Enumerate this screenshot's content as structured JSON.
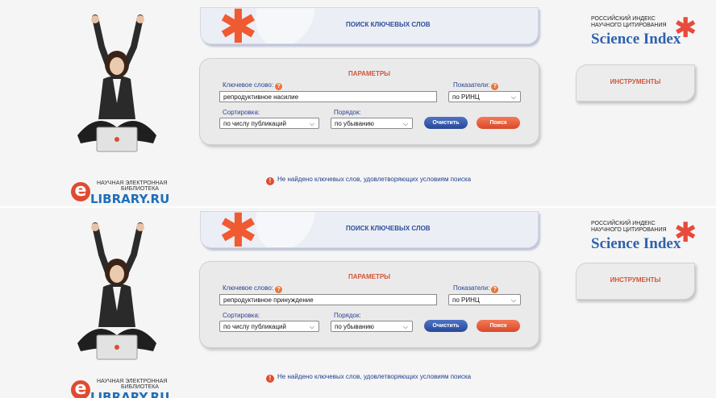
{
  "panels": [
    {
      "title": "ПОИСК КЛЮЧЕВЫХ СЛОВ",
      "params_title": "ПАРАМЕТРЫ",
      "keyword_label": "Ключевое слово:",
      "keyword_value": "репродуктивное насилие",
      "indicators_label": "Показатели:",
      "indicators_value": "по РИНЦ",
      "sort_label": "Сортировка:",
      "sort_value": "по числу публикаций",
      "order_label": "Порядок:",
      "order_value": "по убыванию",
      "clear_button": "Очистить",
      "search_button": "Поиск",
      "tools_title": "ИНСТРУМЕНТЫ",
      "message": "Не найдено ключевых слов, удовлетворяющих условиям поиска",
      "science_index": {
        "line1": "РОССИЙСКИЙ ИНДЕКС",
        "line2": "НАУЧНОГО ЦИТИРОВАНИЯ",
        "brand": "Science Index"
      },
      "elibrary": {
        "line1": "НАУЧНАЯ ЭЛЕКТРОННАЯ",
        "line2": "БИБЛИОТЕКА",
        "brand": "LIBRARY.RU"
      }
    },
    {
      "title": "ПОИСК КЛЮЧЕВЫХ СЛОВ",
      "params_title": "ПАРАМЕТРЫ",
      "keyword_label": "Ключевое слово:",
      "keyword_value": "репродуктивное принуждение",
      "indicators_label": "Показатели:",
      "indicators_value": "по РИНЦ",
      "sort_label": "Сортировка:",
      "sort_value": "по числу публикаций",
      "order_label": "Порядок:",
      "order_value": "по убыванию",
      "clear_button": "Очистить",
      "search_button": "Поиск",
      "tools_title": "ИНСТРУМЕНТЫ",
      "message": "Не найдено ключевых слов, удовлетворяющих условиям поиска",
      "science_index": {
        "line1": "РОССИЙСКИЙ ИНДЕКС",
        "line2": "НАУЧНОГО ЦИТИРОВАНИЯ",
        "brand": "Science Index"
      },
      "elibrary": {
        "line1": "НАУЧНАЯ ЭЛЕКТРОННАЯ",
        "line2": "БИБЛИОТЕКА",
        "brand": "LIBRARY.RU"
      }
    }
  ],
  "colors": {
    "accent_orange": "#d2553a",
    "link_blue": "#2a3f93",
    "brand_blue": "#2f62ad"
  }
}
